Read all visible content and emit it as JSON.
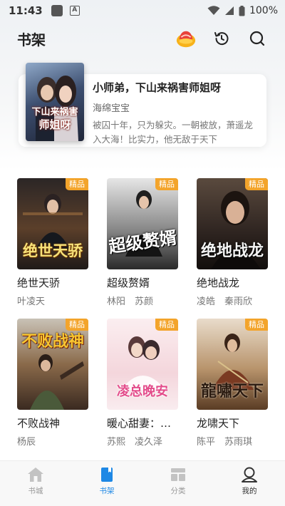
{
  "status_bar": {
    "time": "11:43",
    "battery": "100%"
  },
  "header": {
    "title": "书架"
  },
  "featured": {
    "cover_line1": "下山来祸害",
    "cover_line2": "师姐呀",
    "title": "小师弟，下山来祸害师姐呀",
    "author": "海绵宝宝",
    "description": "被囚十年，只为躲灾。一朝被放，萧遥龙入大海！比实力，他无敌于天下"
  },
  "badge_label": "精品",
  "books": [
    {
      "cover_text": "绝世天骄",
      "title": "绝世天骄",
      "author": "叶凌天"
    },
    {
      "cover_text": "超级赘婿",
      "title": "超级赘婿",
      "author": "林阳　苏颜"
    },
    {
      "cover_text": "绝地战龙",
      "title": "绝地战龙",
      "author": "凌皓　秦雨欣"
    },
    {
      "cover_text": "不败战神",
      "title": "不败战神",
      "author": "杨辰"
    },
    {
      "cover_text": "凌总晚安",
      "title": "暖心甜妻：…",
      "author": "苏熙　凌久泽"
    },
    {
      "cover_text": "龍嘯天下",
      "title": "龙啸天下",
      "author": "陈平　苏雨琪"
    }
  ],
  "tabs": [
    {
      "label": "书城"
    },
    {
      "label": "书架"
    },
    {
      "label": "分类"
    },
    {
      "label": "我的"
    }
  ],
  "colors": {
    "accent": "#1e88e5",
    "badge": "#f3a42b"
  }
}
